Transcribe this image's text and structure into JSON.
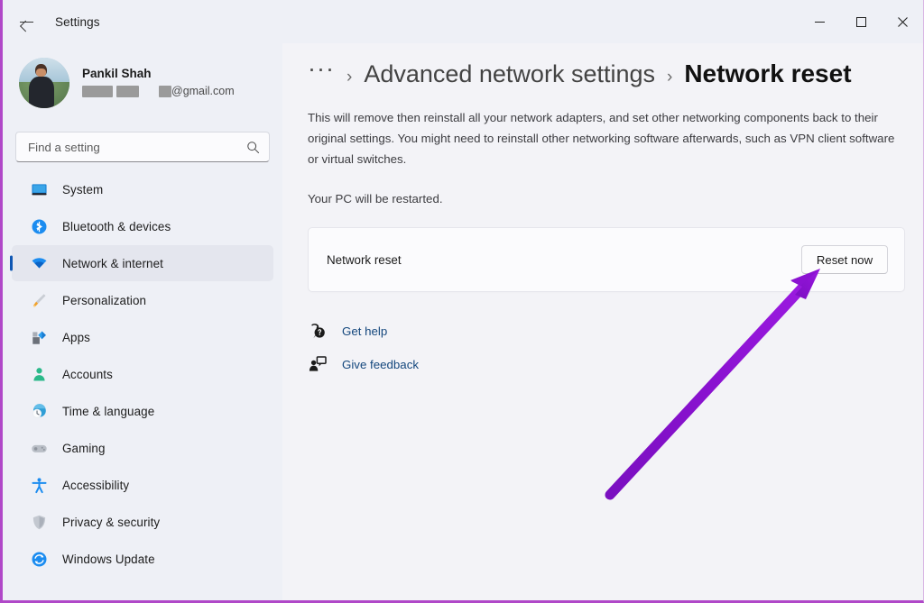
{
  "window": {
    "title": "Settings",
    "back_icon": "back-arrow-icon",
    "controls": {
      "minimize": "minimize-icon",
      "maximize": "maximize-icon",
      "close": "close-icon"
    }
  },
  "account": {
    "name": "Pankil Shah",
    "email_suffix": "@gmail.com",
    "avatar": "user-avatar"
  },
  "search": {
    "placeholder": "Find a setting",
    "icon": "search-icon"
  },
  "sidebar": {
    "items": [
      {
        "label": "System",
        "icon": "monitor-icon",
        "selected": false
      },
      {
        "label": "Bluetooth & devices",
        "icon": "bluetooth-icon",
        "selected": false
      },
      {
        "label": "Network & internet",
        "icon": "wifi-icon",
        "selected": true
      },
      {
        "label": "Personalization",
        "icon": "paintbrush-icon",
        "selected": false
      },
      {
        "label": "Apps",
        "icon": "apps-icon",
        "selected": false
      },
      {
        "label": "Accounts",
        "icon": "person-icon",
        "selected": false
      },
      {
        "label": "Time & language",
        "icon": "clock-globe-icon",
        "selected": false
      },
      {
        "label": "Gaming",
        "icon": "gamepad-icon",
        "selected": false
      },
      {
        "label": "Accessibility",
        "icon": "accessibility-icon",
        "selected": false
      },
      {
        "label": "Privacy & security",
        "icon": "shield-icon",
        "selected": false
      },
      {
        "label": "Windows Update",
        "icon": "update-icon",
        "selected": false
      }
    ]
  },
  "main": {
    "breadcrumb": {
      "overflow": "···",
      "separator": "›",
      "parent": "Advanced network settings",
      "current": "Network reset"
    },
    "description_1": "This will remove then reinstall all your network adapters, and set other networking components back to their original settings. You might need to reinstall other networking software afterwards, such as VPN client software or virtual switches.",
    "description_2": "Your PC will be restarted.",
    "card": {
      "label": "Network reset",
      "button": "Reset now"
    },
    "links": [
      {
        "label": "Get help",
        "icon": "help-question-bubble-icon"
      },
      {
        "label": "Give feedback",
        "icon": "feedback-person-bubble-icon"
      }
    ]
  },
  "annotation": {
    "type": "arrow",
    "color": "#8b12d1",
    "points_to": "Reset now"
  },
  "colors": {
    "accent": "#0f57b3",
    "window_bg": "#f3f3f7",
    "sidebar_bg": "#eef0f6",
    "card_bg": "#fbfbfd",
    "link": "#14477d",
    "annotation": "#8b12d1",
    "border_highlight": "#b048c8"
  }
}
